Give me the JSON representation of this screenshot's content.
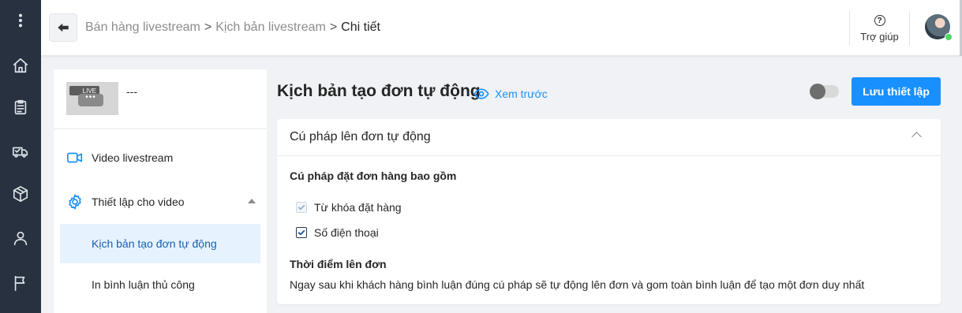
{
  "rail": {
    "items": [
      {
        "icon": "more-vertical-icon"
      },
      {
        "icon": "home-icon"
      },
      {
        "icon": "clipboard-icon"
      },
      {
        "icon": "delivery-truck-icon"
      },
      {
        "icon": "box-icon"
      },
      {
        "icon": "user-icon"
      },
      {
        "icon": "flag-icon"
      }
    ]
  },
  "header": {
    "breadcrumb": [
      {
        "label": "Bán hàng livestream"
      },
      {
        "label": "Kịch bản livestream"
      },
      {
        "label": "Chi tiết"
      }
    ],
    "separator": ">",
    "help_icon": "?",
    "help_label": "Trợ giúp",
    "status_color": "#4cd964"
  },
  "sidebar": {
    "video_badge": "LIVE",
    "video_bubble": "•••",
    "video_title": "---",
    "items": [
      {
        "label": "Video livestream",
        "icon": "video-camera-icon"
      },
      {
        "label": "Thiết lập cho video",
        "icon": "settings-gear-icon",
        "expanded": true
      }
    ],
    "sub_items": [
      {
        "label": "Kịch bản tạo đơn tự động",
        "active": true
      },
      {
        "label": "In bình luận thủ công",
        "active": false
      }
    ]
  },
  "main": {
    "title": "Kịch bản tạo đơn tự động",
    "preview_label": "Xem trước",
    "toggle_on": false,
    "save_label": "Lưu thiết lập",
    "accent_color": "#1890ff",
    "card": {
      "title": "Cú pháp lên đơn tự động",
      "syntax_heading": "Cú pháp đặt đơn hàng bao gồm",
      "options": [
        {
          "label": "Từ khóa đặt hàng",
          "checked": true,
          "disabled": true
        },
        {
          "label": "Số điện thoại",
          "checked": true,
          "disabled": false
        }
      ],
      "timing_heading": "Thời điểm lên đơn",
      "timing_desc": "Ngay sau khi khách hàng bình luận đúng cú pháp sẽ tự động lên đơn và gom toàn bình luận để tạo một đơn duy nhất"
    }
  }
}
